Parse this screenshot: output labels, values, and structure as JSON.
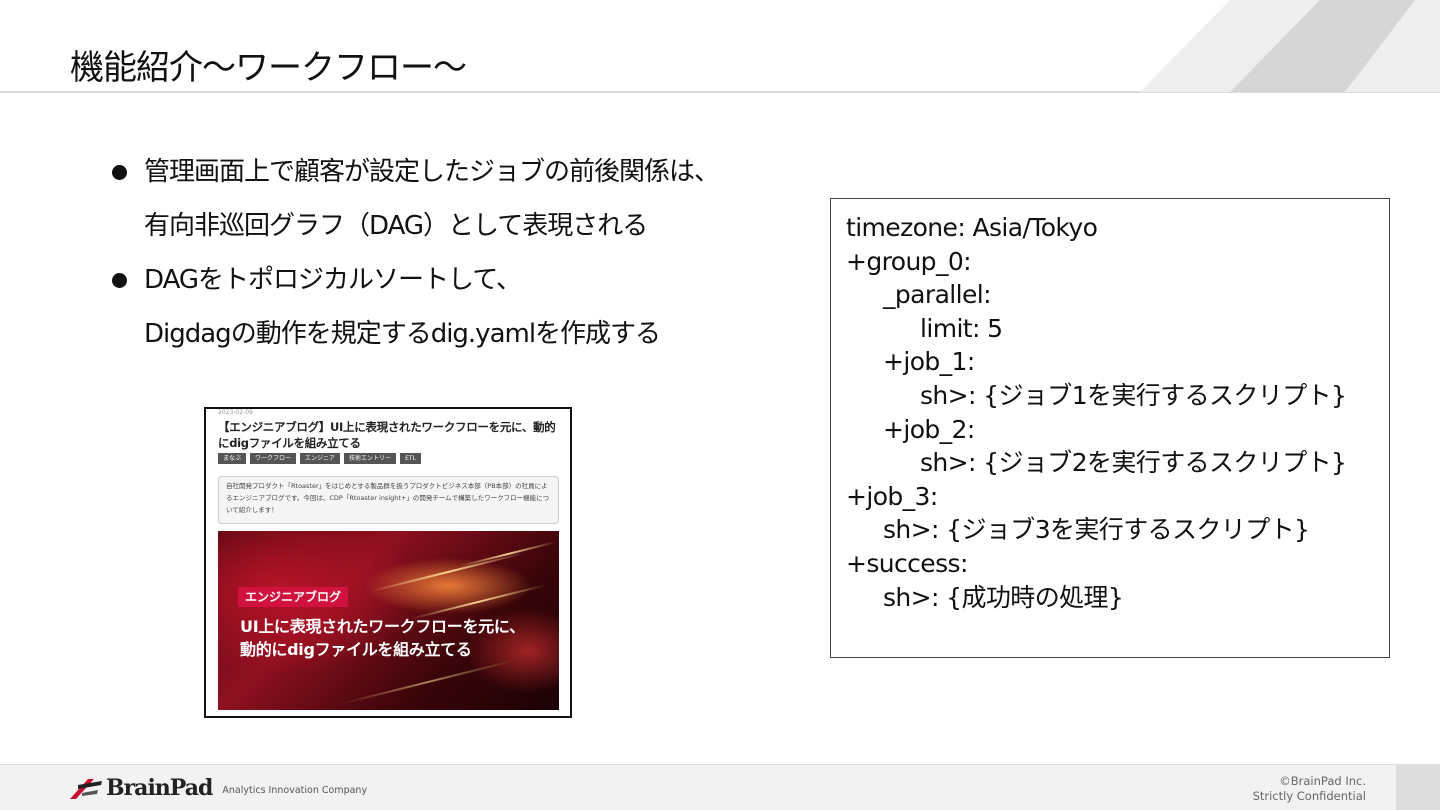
{
  "header": {
    "title": "機能紹介～ワークフロー～"
  },
  "bullets": [
    {
      "lines": [
        "管理画面上で顧客が設定したジョブの前後関係は、",
        "有向非巡回グラフ（DAG）として表現される"
      ]
    },
    {
      "lines": [
        "DAGをトポロジカルソートして、",
        "Digdagの動作を規定するdig.yamlを作成する"
      ]
    }
  ],
  "article": {
    "date": "2023-02-09",
    "title": "【エンジニアブログ】UI上に表現されたワークフローを元に、動的にdigファイルを組み立てる",
    "tags": [
      "まなぶ",
      "ワークフロー",
      "エンジニア",
      "技術エントリー",
      "ETL"
    ],
    "description": "自社開発プロダクト「Rtoaster」をはじめとする製品群を扱うプロダクトビジネス本部（PB本部）の社員によるエンジニアブログです。今回は、CDP「Rtoaster insight+」の開発チームで構築したワークフロー機能について紹介します！",
    "banner_badge": "エンジニアブログ",
    "banner_line1": "UI上に表現されたワークフローを元に、",
    "banner_line2": "動的にdigファイルを組み立てる"
  },
  "code": {
    "lines": [
      {
        "indent": 0,
        "text": "timezone: Asia/Tokyo"
      },
      {
        "indent": 0,
        "text": "+group_0:"
      },
      {
        "indent": 1,
        "text": "_parallel:"
      },
      {
        "indent": 2,
        "text": "limit: 5"
      },
      {
        "indent": 1,
        "text": "+job_1:"
      },
      {
        "indent": 2,
        "text": "sh>: {ジョブ1を実行するスクリプト}"
      },
      {
        "indent": 1,
        "text": "+job_2:"
      },
      {
        "indent": 2,
        "text": "sh>: {ジョブ2を実行するスクリプト}"
      },
      {
        "indent": 0,
        "text": "+job_3:"
      },
      {
        "indent": 1,
        "text": "sh>: {ジョブ3を実行するスクリプト}"
      },
      {
        "indent": 0,
        "text": "+success:"
      },
      {
        "indent": 1,
        "text": "sh>: {成功時の処理}"
      }
    ]
  },
  "footer": {
    "logo_name": "BrainPad",
    "logo_tagline": "Analytics Innovation Company",
    "copyright": "©BrainPad Inc.",
    "confidential": "Strictly Confidential"
  },
  "colors": {
    "banner_badge": "#d1123f",
    "logo_red": "#c8102e"
  }
}
